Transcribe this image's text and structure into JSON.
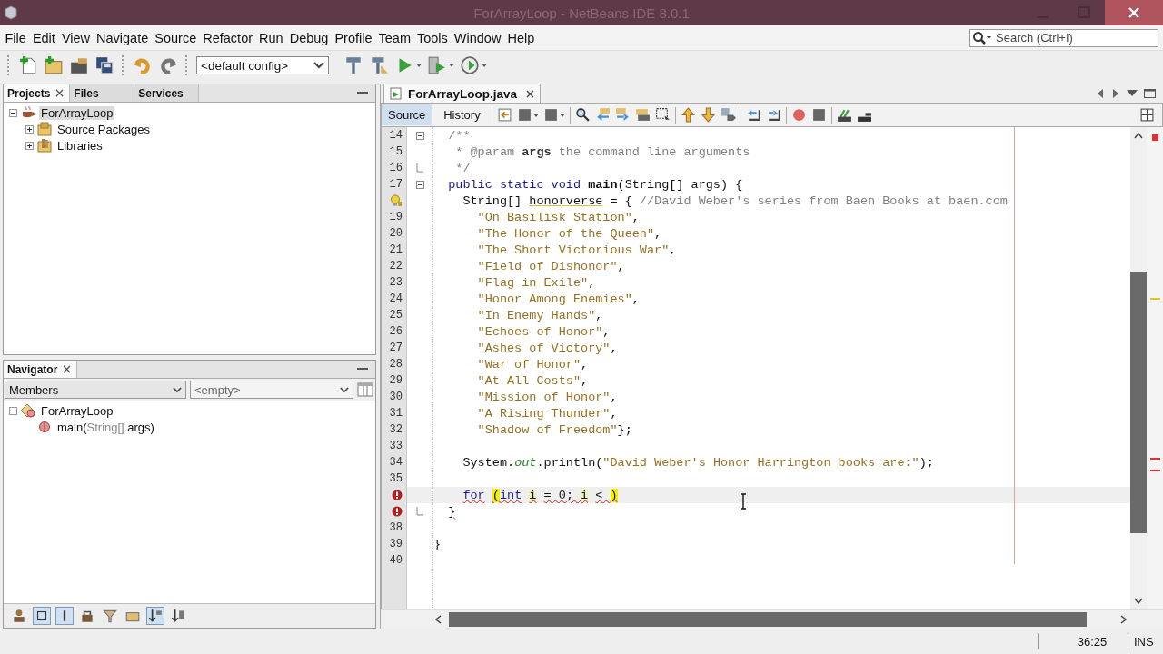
{
  "window": {
    "title": "ForArrayLoop - NetBeans IDE 8.0.1"
  },
  "menu": [
    "File",
    "Edit",
    "View",
    "Navigate",
    "Source",
    "Refactor",
    "Run",
    "Debug",
    "Profile",
    "Team",
    "Tools",
    "Window",
    "Help"
  ],
  "search": {
    "placeholder": "Search (Ctrl+I)"
  },
  "toolbar": {
    "config": "<default config>"
  },
  "projects_panel": {
    "tabs": [
      {
        "label": "Projects",
        "selected": true,
        "closable": true
      },
      {
        "label": "Files",
        "selected": false,
        "closable": false
      },
      {
        "label": "Services",
        "selected": false,
        "closable": false
      }
    ],
    "tree": [
      {
        "label": "ForArrayLoop",
        "kind": "project",
        "expanded": true,
        "selected": true,
        "children": [
          {
            "label": "Source Packages",
            "kind": "package",
            "expanded": false,
            "selected": false
          },
          {
            "label": "Libraries",
            "kind": "library",
            "expanded": false,
            "selected": false
          }
        ]
      }
    ]
  },
  "navigator": {
    "title": "Navigator",
    "view": "Members",
    "filter": "<empty>",
    "tree": [
      {
        "kind": "class",
        "expanded": true,
        "segments": [
          {
            "text": "ForArrayLoop",
            "muted": false
          }
        ],
        "children": [
          {
            "kind": "method",
            "segments": [
              {
                "text": "main(",
                "muted": false
              },
              {
                "text": "String[]",
                "muted": true
              },
              {
                "text": " args)",
                "muted": false
              }
            ]
          }
        ]
      }
    ]
  },
  "editor": {
    "file_tab": "ForArrayLoop.java",
    "view_tabs": [
      {
        "label": "Source",
        "selected": true
      },
      {
        "label": "History",
        "selected": false
      }
    ],
    "lines": [
      {
        "kind": "numbered",
        "number": "14",
        "current": false,
        "fold_start": true,
        "fold_end": false,
        "segments": [
          {
            "text": "  /**",
            "kind": "comment"
          }
        ]
      },
      {
        "kind": "numbered",
        "number": "15",
        "current": false,
        "fold_start": false,
        "fold_end": false,
        "segments": [
          {
            "text": "   * @param ",
            "kind": "comment"
          },
          {
            "text": "args",
            "kind": "comment-bold"
          },
          {
            "text": " the command line arguments",
            "kind": "comment"
          }
        ]
      },
      {
        "kind": "numbered",
        "number": "16",
        "current": false,
        "fold_start": false,
        "fold_end": true,
        "segments": [
          {
            "text": "   */",
            "kind": "comment"
          }
        ]
      },
      {
        "kind": "numbered",
        "number": "17",
        "current": false,
        "fold_start": true,
        "fold_end": false,
        "segments": [
          {
            "text": "  public static void",
            "kind": "keyword"
          },
          {
            "text": " main",
            "kind": "method"
          },
          {
            "text": "(String[] args) {",
            "kind": "plain"
          }
        ]
      },
      {
        "kind": "hint",
        "current": false,
        "fold_start": false,
        "fold_end": false,
        "segments": [
          {
            "text": "    String[] ",
            "kind": "plain"
          },
          {
            "text": "honorverse",
            "kind": "unused"
          },
          {
            "text": " = { ",
            "kind": "plain"
          },
          {
            "text": "//David Weber's series from Baen Books at baen.com",
            "kind": "comment"
          }
        ]
      },
      {
        "kind": "numbered",
        "number": "19",
        "current": false,
        "fold_start": false,
        "fold_end": false,
        "segments": [
          {
            "text": "      \"On Basilisk Station\"",
            "kind": "string"
          },
          {
            "text": ",",
            "kind": "plain"
          }
        ]
      },
      {
        "kind": "numbered",
        "number": "20",
        "current": false,
        "fold_start": false,
        "fold_end": false,
        "segments": [
          {
            "text": "      \"The Honor of the Queen\"",
            "kind": "string"
          },
          {
            "text": ",",
            "kind": "plain"
          }
        ]
      },
      {
        "kind": "numbered",
        "number": "21",
        "current": false,
        "fold_start": false,
        "fold_end": false,
        "segments": [
          {
            "text": "      \"The Short Victorious War\"",
            "kind": "string"
          },
          {
            "text": ",",
            "kind": "plain"
          }
        ]
      },
      {
        "kind": "numbered",
        "number": "22",
        "current": false,
        "fold_start": false,
        "fold_end": false,
        "segments": [
          {
            "text": "      \"Field of Dishonor\"",
            "kind": "string"
          },
          {
            "text": ",",
            "kind": "plain"
          }
        ]
      },
      {
        "kind": "numbered",
        "number": "23",
        "current": false,
        "fold_start": false,
        "fold_end": false,
        "segments": [
          {
            "text": "      \"Flag in Exile\"",
            "kind": "string"
          },
          {
            "text": ",",
            "kind": "plain"
          }
        ]
      },
      {
        "kind": "numbered",
        "number": "24",
        "current": false,
        "fold_start": false,
        "fold_end": false,
        "segments": [
          {
            "text": "      \"Honor Among Enemies\"",
            "kind": "string"
          },
          {
            "text": ",",
            "kind": "plain"
          }
        ]
      },
      {
        "kind": "numbered",
        "number": "25",
        "current": false,
        "fold_start": false,
        "fold_end": false,
        "segments": [
          {
            "text": "      \"In Enemy Hands\"",
            "kind": "string"
          },
          {
            "text": ",",
            "kind": "plain"
          }
        ]
      },
      {
        "kind": "numbered",
        "number": "26",
        "current": false,
        "fold_start": false,
        "fold_end": false,
        "segments": [
          {
            "text": "      \"Echoes of Honor\"",
            "kind": "string"
          },
          {
            "text": ",",
            "kind": "plain"
          }
        ]
      },
      {
        "kind": "numbered",
        "number": "27",
        "current": false,
        "fold_start": false,
        "fold_end": false,
        "segments": [
          {
            "text": "      \"Ashes of Victory\"",
            "kind": "string"
          },
          {
            "text": ",",
            "kind": "plain"
          }
        ]
      },
      {
        "kind": "numbered",
        "number": "28",
        "current": false,
        "fold_start": false,
        "fold_end": false,
        "segments": [
          {
            "text": "      \"War of Honor\"",
            "kind": "string"
          },
          {
            "text": ",",
            "kind": "plain"
          }
        ]
      },
      {
        "kind": "numbered",
        "number": "29",
        "current": false,
        "fold_start": false,
        "fold_end": false,
        "segments": [
          {
            "text": "      \"At All Costs\"",
            "kind": "string"
          },
          {
            "text": ",",
            "kind": "plain"
          }
        ]
      },
      {
        "kind": "numbered",
        "number": "30",
        "current": false,
        "fold_start": false,
        "fold_end": false,
        "segments": [
          {
            "text": "      \"Mission of Honor\"",
            "kind": "string"
          },
          {
            "text": ",",
            "kind": "plain"
          }
        ]
      },
      {
        "kind": "numbered",
        "number": "31",
        "current": false,
        "fold_start": false,
        "fold_end": false,
        "segments": [
          {
            "text": "      \"A Rising Thunder\"",
            "kind": "string"
          },
          {
            "text": ",",
            "kind": "plain"
          }
        ]
      },
      {
        "kind": "numbered",
        "number": "32",
        "current": false,
        "fold_start": false,
        "fold_end": false,
        "segments": [
          {
            "text": "      \"Shadow of Freedom\"",
            "kind": "string"
          },
          {
            "text": "};",
            "kind": "plain"
          }
        ]
      },
      {
        "kind": "numbered",
        "number": "33",
        "current": false,
        "fold_start": false,
        "fold_end": false
      },
      {
        "kind": "numbered",
        "number": "34",
        "current": false,
        "fold_start": false,
        "fold_end": false,
        "segments": [
          {
            "text": "    System.",
            "kind": "plain"
          },
          {
            "text": "out",
            "kind": "field"
          },
          {
            "text": ".println(",
            "kind": "plain"
          },
          {
            "text": "\"David Weber's Honor Harrington books are:\"",
            "kind": "string"
          },
          {
            "text": ");",
            "kind": "plain"
          }
        ]
      },
      {
        "kind": "numbered",
        "number": "35",
        "current": false,
        "fold_start": false,
        "fold_end": false
      },
      {
        "kind": "error",
        "current": true,
        "fold_start": false,
        "fold_end": false,
        "segments": [
          {
            "text": "    for",
            "kind": "keyword",
            "error": true
          },
          {
            "text": " (",
            "kind": "bracket-match",
            "error": true
          },
          {
            "text": "int",
            "kind": "keyword",
            "error": true
          },
          {
            "text": " i",
            "kind": "occurrence",
            "error": true
          },
          {
            "text": " = 0; ",
            "kind": "plain",
            "error": true
          },
          {
            "text": "i",
            "kind": "occurrence",
            "error": true
          },
          {
            "text": " < ",
            "kind": "plain",
            "error": true
          },
          {
            "text": ")",
            "kind": "bracket-match",
            "error": true
          }
        ]
      },
      {
        "kind": "error",
        "current": false,
        "fold_start": false,
        "fold_end": true,
        "segments": [
          {
            "text": "  }",
            "kind": "plain",
            "error": true
          }
        ]
      },
      {
        "kind": "numbered",
        "number": "38",
        "current": false,
        "fold_start": false,
        "fold_end": false
      },
      {
        "kind": "numbered",
        "number": "39",
        "current": false,
        "fold_start": false,
        "fold_end": false,
        "segments": [
          {
            "text": "}",
            "kind": "plain"
          }
        ]
      },
      {
        "kind": "numbered",
        "number": "40",
        "current": false,
        "fold_start": false,
        "fold_end": false
      }
    ]
  },
  "status_bar": {
    "position": "36:25",
    "mode": "INS"
  }
}
